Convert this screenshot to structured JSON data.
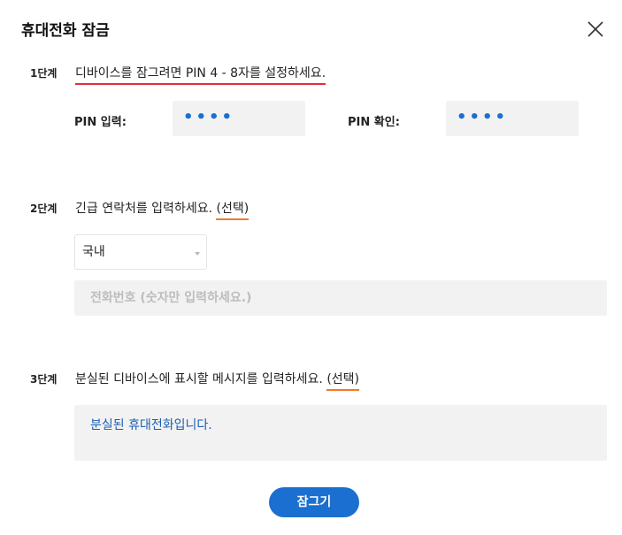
{
  "dialog": {
    "title": "휴대전화 잠금",
    "close_icon": "close-icon"
  },
  "step1": {
    "label": "1단계",
    "description": "디바이스를 잠그려면 PIN 4 - 8자를 설정하세요.",
    "pin_label": "PIN 입력:",
    "pin_value": "••••",
    "pin_confirm_label": "PIN 확인:",
    "pin_confirm_value": "••••"
  },
  "step2": {
    "label": "2단계",
    "description": "긴급 연락처를 입력하세요.",
    "optional": "(선택)",
    "country_select": "국내",
    "phone_placeholder": "전화번호 (숫자만 입력하세요.)"
  },
  "step3": {
    "label": "3단계",
    "description": "분실된 디바이스에 표시할 메시지를 입력하세요.",
    "optional": "(선택)",
    "message_value": "분실된 휴대전화입니다."
  },
  "actions": {
    "lock_label": "잠그기"
  },
  "colors": {
    "accent": "#1a6fd0",
    "underline_red": "#e0303a",
    "underline_orange": "#f07a2a",
    "field_bg": "#f2f2f2"
  }
}
